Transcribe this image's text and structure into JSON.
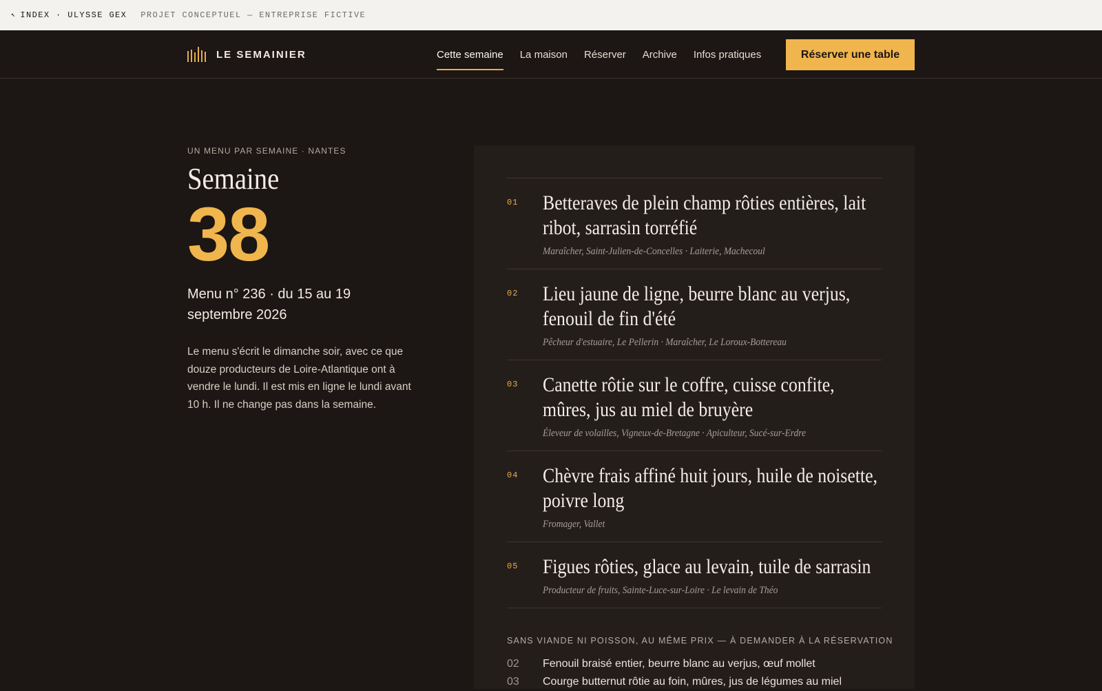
{
  "meta_bar": {
    "back_label": "INDEX · ULYSSE GEX",
    "note": "PROJET CONCEPTUEL — ENTREPRISE FICTIVE"
  },
  "nav": {
    "brand": "LE SEMAINIER",
    "links": [
      "Cette semaine",
      "La maison",
      "Réserver",
      "Archive",
      "Infos pratiques"
    ],
    "active_link": "Cette semaine",
    "cta": "Réserver une table"
  },
  "intro": {
    "eyebrow": "UN MENU PAR SEMAINE · NANTES",
    "week_word": "Semaine",
    "week_number": "38",
    "menu_meta": "Menu n° 236 · du 15 au 19 septembre 2026",
    "description": "Le menu s'écrit le dimanche soir, avec ce que douze producteurs de Loire-Atlantique ont à vendre le lundi. Il est mis en ligne le lundi avant 10 h. Il ne change pas dans la semaine."
  },
  "menu": {
    "courses": [
      {
        "num": "01",
        "name": "Betteraves de plein champ rôties entières, lait ribot, sarrasin torréfié",
        "origin": "Maraîcher, Saint-Julien-de-Concelles · Laiterie, Machecoul"
      },
      {
        "num": "02",
        "name": "Lieu jaune de ligne, beurre blanc au verjus, fenouil de fin d'été",
        "origin": "Pêcheur d'estuaire, Le Pellerin · Maraîcher, Le Loroux-Bottereau"
      },
      {
        "num": "03",
        "name": "Canette rôtie sur le coffre, cuisse confite, mûres, jus au miel de bruyère",
        "origin": "Éleveur de volailles, Vigneux-de-Bretagne · Apiculteur, Sucé-sur-Erdre"
      },
      {
        "num": "04",
        "name": "Chèvre frais affiné huit jours, huile de noisette, poivre long",
        "origin": "Fromager, Vallet"
      },
      {
        "num": "05",
        "name": "Figues rôties, glace au levain, tuile de sarrasin",
        "origin": "Producteur de fruits, Sainte-Luce-sur-Loire · Le levain de Théo"
      }
    ],
    "veg_title": "SANS VIANDE NI POISSON, AU MÊME PRIX — À DEMANDER À LA RÉSERVATION",
    "veg_items": [
      {
        "num": "02",
        "text": "Fenouil braisé entier, beurre blanc au verjus, œuf mollet"
      },
      {
        "num": "03",
        "text": "Courge butternut rôtie au foin, mûres, jus de légumes au miel"
      }
    ]
  },
  "colors": {
    "background": "#1c1614",
    "card": "#241e1b",
    "accent": "#f0b54c",
    "meta_bar": "#f3f2ee"
  }
}
